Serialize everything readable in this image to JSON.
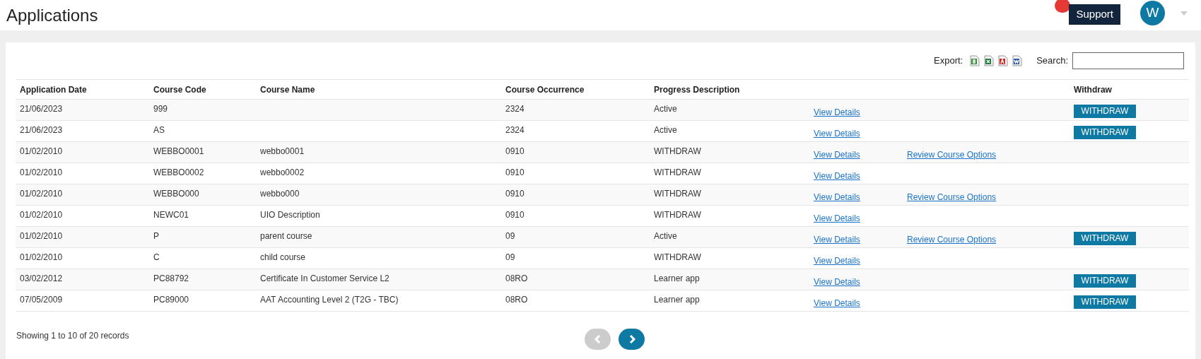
{
  "page_title": "Applications",
  "header": {
    "support_label": "Support",
    "avatar_initial": "W"
  },
  "toolbar": {
    "export_label": "Export:",
    "search_label": "Search:"
  },
  "table": {
    "columns": [
      "Application Date",
      "Course Code",
      "Course Name",
      "Course Occurrence",
      "Progress Description",
      "",
      "",
      "Withdraw"
    ],
    "rows": [
      {
        "date": "21/06/2023",
        "code": "999",
        "name": "",
        "occurrence": "2324",
        "progress": "Active",
        "view": "View Details",
        "withdraw": "WITHDRAW"
      },
      {
        "date": "21/06/2023",
        "code": "AS",
        "name": "",
        "occurrence": "2324",
        "progress": "Active",
        "view": "View Details",
        "withdraw": "WITHDRAW"
      },
      {
        "date": "01/02/2010",
        "code": "WEBBO0001",
        "name": "webbo0001",
        "occurrence": "0910",
        "progress": "WITHDRAW",
        "view": "View Details",
        "review": "Review Course Options"
      },
      {
        "date": "01/02/2010",
        "code": "WEBBO0002",
        "name": "webbo0002",
        "occurrence": "0910",
        "progress": "WITHDRAW",
        "view": "View Details"
      },
      {
        "date": "01/02/2010",
        "code": "WEBBO000",
        "name": "webbo000",
        "occurrence": "0910",
        "progress": "WITHDRAW",
        "view": "View Details",
        "review": "Review Course Options"
      },
      {
        "date": "01/02/2010",
        "code": "NEWC01",
        "name": "UIO Description",
        "occurrence": "0910",
        "progress": "WITHDRAW",
        "view": "View Details"
      },
      {
        "date": "01/02/2010",
        "code": "P",
        "name": "parent course",
        "occurrence": "09",
        "progress": "Active",
        "view": "View Details",
        "review": "Review Course Options",
        "withdraw": "WITHDRAW"
      },
      {
        "date": "01/02/2010",
        "code": "C",
        "name": "child course",
        "occurrence": "09",
        "progress": "WITHDRAW",
        "view": "View Details"
      },
      {
        "date": "03/02/2012",
        "code": "PC88792",
        "name": "Certificate In Customer Service L2",
        "occurrence": "08RO",
        "progress": "Learner app",
        "view": "View Details",
        "withdraw": "WITHDRAW"
      },
      {
        "date": "07/05/2009",
        "code": "PC89000",
        "name": "AAT Accounting Level 2 (T2G - TBC)",
        "occurrence": "08RO",
        "progress": "Learner app",
        "view": "View Details",
        "withdraw": "WITHDRAW"
      }
    ]
  },
  "footer": {
    "info": "Showing 1 to 10 of 20 records",
    "prev": {
      "disabled": true
    },
    "next": {
      "disabled": false
    }
  }
}
